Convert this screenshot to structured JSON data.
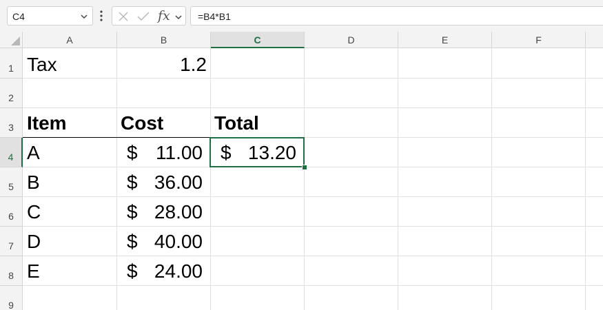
{
  "formula_bar": {
    "name_box": "C4",
    "formula": "=B4*B1",
    "fx_label": "fx"
  },
  "columns": [
    "A",
    "B",
    "C",
    "D",
    "E",
    "F"
  ],
  "selected_column": "C",
  "rows": [
    "1",
    "2",
    "3",
    "4",
    "5",
    "6",
    "7",
    "8",
    "9"
  ],
  "selected_row": "4",
  "cells": {
    "a1": "Tax",
    "b1": "1.2",
    "a3": "Item",
    "b3": "Cost",
    "c3": "Total",
    "a4": "A",
    "a5": "B",
    "a6": "C",
    "a7": "D",
    "a8": "E",
    "currency_symbol": "$",
    "b4": "11.00",
    "b5": "36.00",
    "b6": "28.00",
    "b7": "40.00",
    "b8": "24.00",
    "c4": "13.20"
  },
  "accent_color": "#1f6e43"
}
